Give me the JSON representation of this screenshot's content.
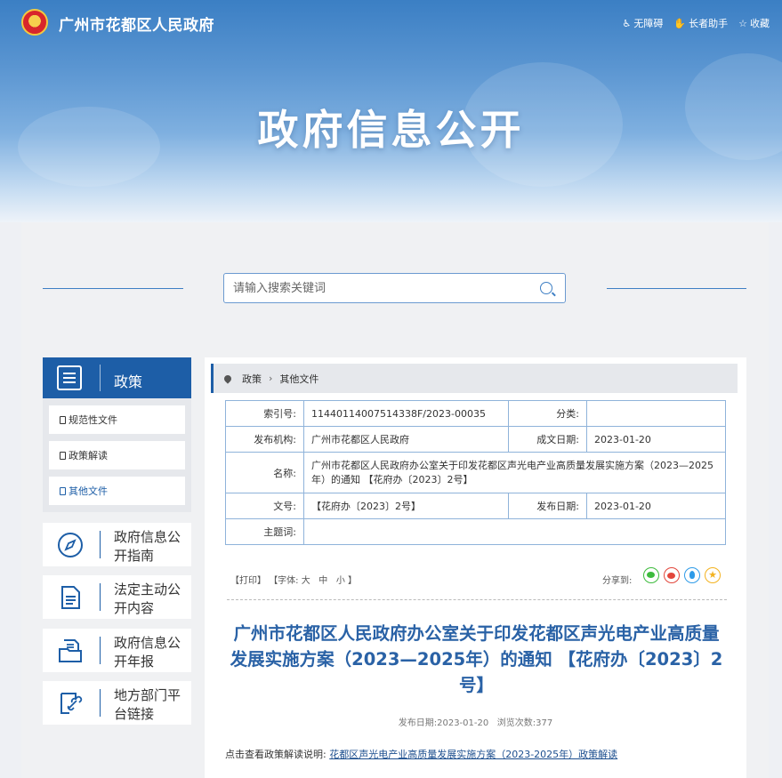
{
  "header": {
    "site_title": "广州市花都区人民政府",
    "links": [
      {
        "label": "无障碍",
        "icon": "accessibility-icon"
      },
      {
        "label": "长者助手",
        "icon": "elder-helper-icon"
      },
      {
        "label": "收藏",
        "icon": "star-icon"
      }
    ],
    "hero_title": "政府信息公开"
  },
  "search": {
    "placeholder": "请输入搜索关键词"
  },
  "sidebar": {
    "heading": "政策",
    "sub_items": [
      {
        "label": "规范性文件",
        "active": false
      },
      {
        "label": "政策解读",
        "active": false
      },
      {
        "label": "其他文件",
        "active": true
      }
    ],
    "items": [
      {
        "label": "政府信息公开指南",
        "icon": "compass-icon"
      },
      {
        "label": "法定主动公开内容",
        "icon": "document-list-icon"
      },
      {
        "label": "政府信息公开年报",
        "icon": "folder-report-icon"
      },
      {
        "label": "地方部门平台链接",
        "icon": "link-icon"
      }
    ]
  },
  "breadcrumb": [
    "政策",
    "其他文件"
  ],
  "meta": {
    "index_label": "索引号:",
    "index_value": "11440114007514338F/2023-00035",
    "category_label": "分类:",
    "category_value": "",
    "publisher_label": "发布机构:",
    "publisher_value": "广州市花都区人民政府",
    "created_label": "成文日期:",
    "created_value": "2023-01-20",
    "name_label": "名称:",
    "name_value": "广州市花都区人民政府办公室关于印发花都区声光电产业高质量发展实施方案（2023—2025年）的通知 【花府办〔2023〕2号】",
    "docno_label": "文号:",
    "docno_value": "【花府办〔2023〕2号】",
    "published_label": "发布日期:",
    "published_value": "2023-01-20",
    "keywords_label": "主题词:",
    "keywords_value": ""
  },
  "tools": {
    "print": "【打印】",
    "font": "【字体:",
    "large": "大",
    "medium": "中",
    "small": "小",
    "close": "】"
  },
  "share": {
    "label": "分享到:",
    "targets": [
      {
        "icon": "wechat-icon",
        "color": "#3dbb3d"
      },
      {
        "icon": "weibo-icon",
        "color": "#e2463b"
      },
      {
        "icon": "qq-icon",
        "color": "#2e9be8"
      },
      {
        "icon": "qzone-icon",
        "color": "#f3b21f"
      }
    ]
  },
  "document": {
    "title": "广州市花都区人民政府办公室关于印发花都区声光电产业高质量发展实施方案（2023—2025年）的通知 【花府办〔2023〕2号】",
    "pub_date_label": "发布日期:",
    "pub_date": "2023-01-20",
    "views_label": "浏览次数:",
    "views": "377",
    "policy_prefix": "点击查看政策解读说明:",
    "policy_link": "花都区声光电产业高质量发展实施方案（2023-2025年）政策解读"
  },
  "colors": {
    "brand_blue": "#1d5ea7",
    "title_blue": "#2a62a6"
  }
}
